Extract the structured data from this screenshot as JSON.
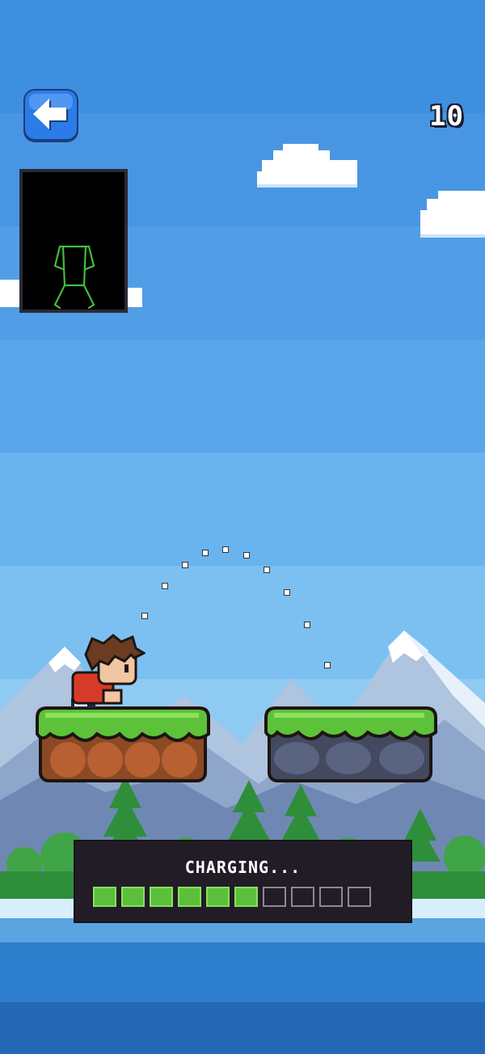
{
  "game": {
    "score": "10",
    "charge": {
      "label": "CHARGING...",
      "level": 6,
      "max": 10
    }
  },
  "icons": {
    "back": "arrow-left-icon",
    "pose": "stick-figure-pose-icon"
  },
  "colors": {
    "sky_top": "#3f8fe0",
    "sky_bottom": "#8cc7f3",
    "grass": "#5dc23a",
    "water": "#2d7ecc",
    "charge_fill": "#5cbf3c",
    "button": "#2b7be8"
  }
}
